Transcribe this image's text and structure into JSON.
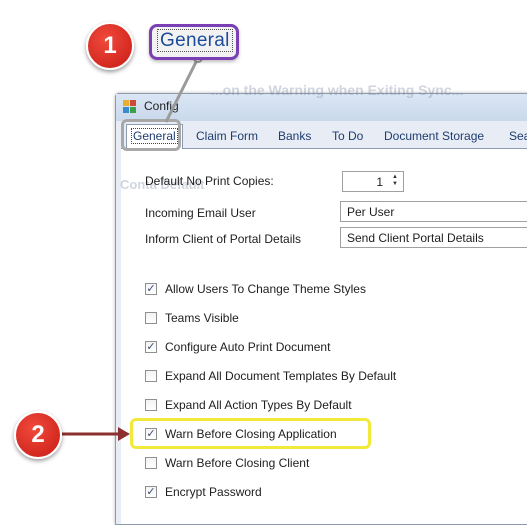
{
  "callout": {
    "label": "General",
    "step1": "1",
    "step2": "2"
  },
  "window": {
    "title": "Config",
    "ghost_text_top": "...on the Warning when Exiting Sync...",
    "ghost_text_mid": "Conta Default"
  },
  "tabs": [
    "General",
    "Claim Form",
    "Banks",
    "To Do",
    "Document Storage",
    "Sea"
  ],
  "form": {
    "copies_label": "Default No Print Copies:",
    "copies_value": "1",
    "email_label": "Incoming Email User",
    "email_value": "Per User",
    "portal_label": "Inform Client of Portal Details",
    "portal_value": "Send Client Portal Details"
  },
  "checkboxes": [
    {
      "label": "Allow Users To Change Theme Styles",
      "checked": true
    },
    {
      "label": "Teams Visible",
      "checked": false
    },
    {
      "label": "Configure Auto Print Document",
      "checked": true
    },
    {
      "label": "Expand All Document Templates By Default",
      "checked": false
    },
    {
      "label": "Expand All Action Types By Default",
      "checked": false
    },
    {
      "label": "Warn Before Closing Application",
      "checked": true
    },
    {
      "label": "Warn Before Closing Client",
      "checked": false
    },
    {
      "label": "Encrypt Password",
      "checked": true
    }
  ],
  "colors": {
    "callout_border": "#7b3fb5",
    "badge_red": "#d9261c",
    "highlight_yellow": "#f2ea3b",
    "arrow": "#8b2f2f"
  }
}
